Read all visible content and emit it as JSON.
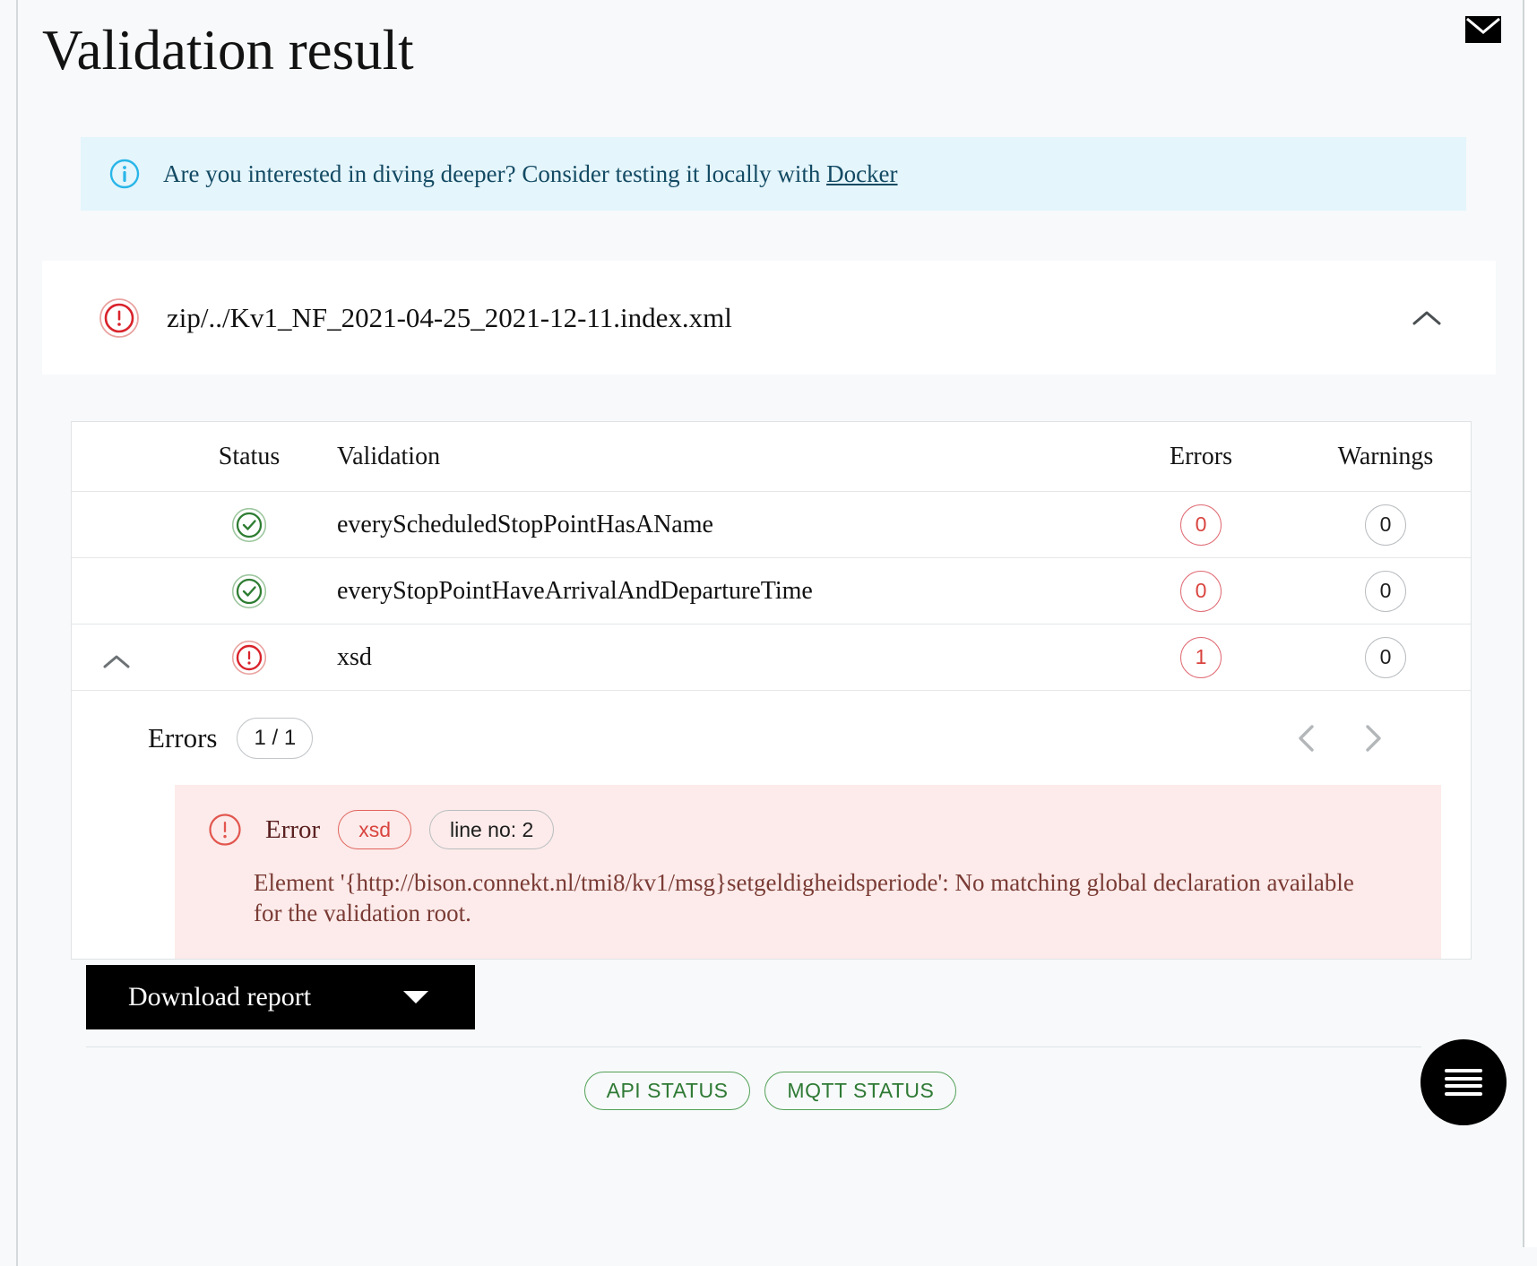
{
  "header": {
    "title": "Validation result",
    "mail_icon": "mail-icon"
  },
  "info_banner": {
    "icon": "info-circle-icon",
    "text_before": "Are you interested in diving deeper? Consider testing it locally with ",
    "link_label": "Docker"
  },
  "file_card": {
    "status_icon": "error-circle-icon",
    "file_name": "zip/../Kv1_NF_2021-04-25_2021-12-11.index.xml",
    "collapse_icon": "chevron-up-icon"
  },
  "table": {
    "columns": {
      "status": "Status",
      "validation": "Validation",
      "errors": "Errors",
      "warnings": "Warnings"
    },
    "rows": [
      {
        "toggle": "",
        "status_icon": "check-circle-icon",
        "validation": "everyScheduledStopPointHasAName",
        "errors": "0",
        "warnings": "0"
      },
      {
        "toggle": "",
        "status_icon": "check-circle-icon",
        "validation": "everyStopPointHaveArrivalAndDepartureTime",
        "errors": "0",
        "warnings": "0"
      },
      {
        "toggle": "chevron-up-icon",
        "status_icon": "error-circle-icon",
        "validation": "xsd",
        "errors": "1",
        "warnings": "0"
      }
    ]
  },
  "errors_section": {
    "label": "Errors",
    "pager": "1 / 1",
    "prev_icon": "chevron-left-icon",
    "next_icon": "chevron-right-icon",
    "error": {
      "icon": "error-circle-icon",
      "severity": "Error",
      "tag": "xsd",
      "line": "line no: 2",
      "message": "Element '{http://bison.connekt.nl/tmi8/kv1/msg}setgeldigheidsperiode': No matching global declaration available for the validation root."
    }
  },
  "download": {
    "label": "Download report",
    "caret_icon": "caret-down-icon"
  },
  "footer": {
    "chips": [
      {
        "label": "API STATUS"
      },
      {
        "label": "MQTT STATUS"
      }
    ],
    "fab_icon": "hamburger-menu-icon"
  },
  "colors": {
    "page_bg": "#f7f9fa",
    "info_bg": "#e4f5fc",
    "info_text": "#134a63",
    "error_red": "#d9443f",
    "error_box_bg": "#fcebea",
    "success_green": "#2e7d32",
    "chip_green": "#2f7a35",
    "button_black": "#000000"
  }
}
